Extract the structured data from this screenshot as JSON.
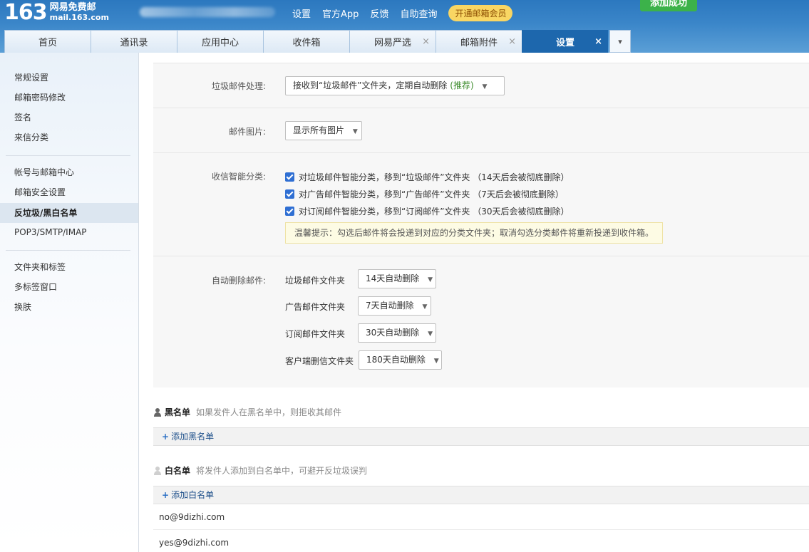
{
  "header": {
    "logo_number": "163",
    "logo_line1": "网易免费邮",
    "logo_line2": "mail.163.com",
    "links": [
      "设置",
      "官方App",
      "反馈",
      "自助查询"
    ],
    "vip_label": "开通邮箱会员",
    "success_label": "添加成功"
  },
  "tabs": [
    {
      "label": "首页",
      "closable": false,
      "active": false
    },
    {
      "label": "通讯录",
      "closable": false,
      "active": false
    },
    {
      "label": "应用中心",
      "closable": false,
      "active": false
    },
    {
      "label": "收件箱",
      "closable": false,
      "active": false
    },
    {
      "label": "网易严选",
      "closable": true,
      "active": false
    },
    {
      "label": "邮箱附件",
      "closable": true,
      "active": false
    },
    {
      "label": "设置",
      "closable": true,
      "active": true
    }
  ],
  "tab_close_glyph": "×",
  "sidebar": {
    "groups": [
      [
        "常规设置",
        "邮箱密码修改",
        "签名",
        "来信分类"
      ],
      [
        "帐号与邮箱中心",
        "邮箱安全设置",
        "反垃圾/黑白名单",
        "POP3/SMTP/IMAP"
      ],
      [
        "文件夹和标签",
        "多标签窗口",
        "换肤"
      ]
    ],
    "active": "反垃圾/黑白名单"
  },
  "spam": {
    "label": "垃圾邮件处理:",
    "value": "接收到“垃圾邮件”文件夹，定期自动删除",
    "recommend": "(推荐)"
  },
  "images": {
    "label": "邮件图片:",
    "value": "显示所有图片"
  },
  "smart": {
    "label": "收信智能分类:",
    "options": [
      "对垃圾邮件智能分类，移到“垃圾邮件”文件夹 （14天后会被彻底删除）",
      "对广告邮件智能分类，移到“广告邮件”文件夹 （7天后会被彻底删除）",
      "对订阅邮件智能分类，移到“订阅邮件”文件夹 （30天后会被彻底删除）"
    ],
    "tip": "温馨提示：勾选后邮件将会投递到对应的分类文件夹；取消勾选分类邮件将重新投递到收件箱。"
  },
  "autodelete": {
    "label": "自动删除邮件:",
    "rows": [
      {
        "folder": "垃圾邮件文件夹",
        "value": "14天自动删除"
      },
      {
        "folder": "广告邮件文件夹",
        "value": "7天自动删除"
      },
      {
        "folder": "订阅邮件文件夹",
        "value": "30天自动删除"
      },
      {
        "folder": "客户端删信文件夹",
        "value": "180天自动删除"
      }
    ]
  },
  "blacklist": {
    "title": "黑名单",
    "desc": "如果发件人在黑名单中，则拒收其邮件",
    "add_label": "添加黑名单",
    "icon_color": "#666666"
  },
  "whitelist": {
    "title": "白名单",
    "desc": "将发件人添加到白名单中，可避开反垃圾误判",
    "add_label": "添加白名单",
    "icon_color": "#cfcfcf",
    "emails": [
      "no@9dizhi.com",
      "yes@9dizhi.com"
    ]
  },
  "colors": {
    "header_blue": "#2c78bf",
    "active_tab": "#1d67ad",
    "checkbox": "#2f6fd3",
    "vip": "#f9d663",
    "success": "#3cb24a"
  }
}
